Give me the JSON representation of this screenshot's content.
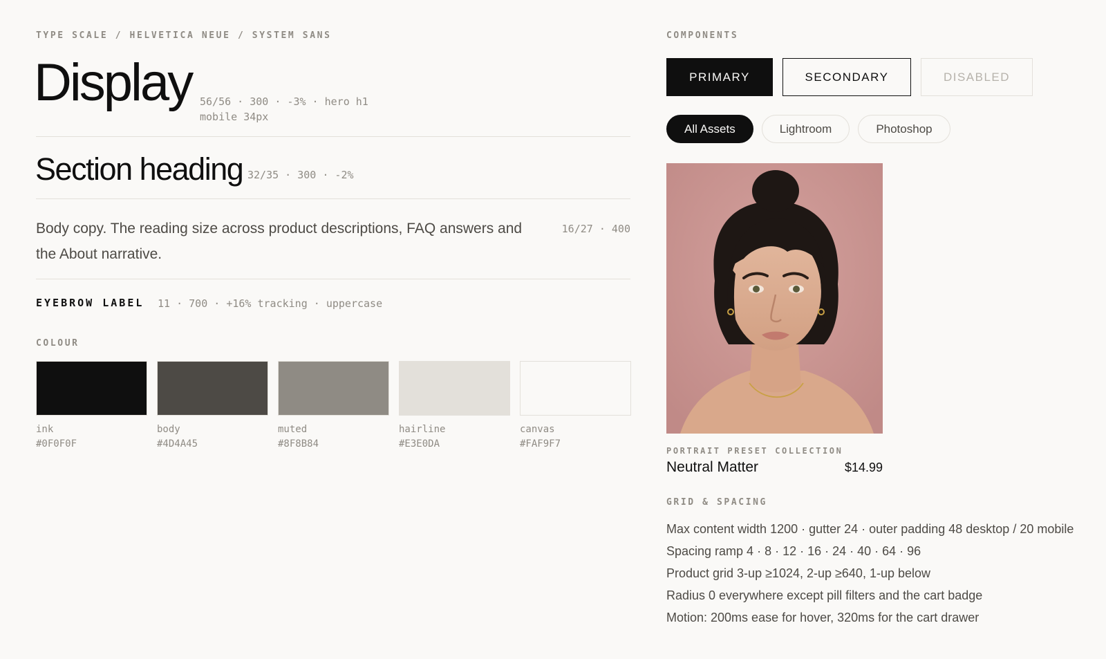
{
  "type_section": {
    "eyebrow": "TYPE SCALE / HELVETICA NEUE / SYSTEM SANS",
    "display": {
      "sample": "Display",
      "meta_line1": "56/56 · 300 · -3% · hero h1",
      "meta_line2": "mobile 34px"
    },
    "section": {
      "sample": "Section heading",
      "meta": "32/35 · 300 · -2%"
    },
    "body": {
      "sample": "Body copy. The reading size across product descriptions, FAQ answers and the About narrative.",
      "meta": "16/27 · 400"
    },
    "eyebrow_row": {
      "sample": "EYEBROW LABEL",
      "meta": "11 · 700 · +16% tracking · uppercase"
    }
  },
  "colour_section": {
    "eyebrow": "COLOUR",
    "swatches": [
      {
        "name": "ink",
        "hex": "#0F0F0F"
      },
      {
        "name": "body",
        "hex": "#4D4A45"
      },
      {
        "name": "muted",
        "hex": "#8F8B84"
      },
      {
        "name": "hairline",
        "hex": "#E3E0DA"
      },
      {
        "name": "canvas",
        "hex": "#FAF9F7"
      }
    ]
  },
  "components": {
    "eyebrow": "COMPONENTS",
    "buttons": {
      "primary": "PRIMARY",
      "secondary": "SECONDARY",
      "disabled": "DISABLED"
    },
    "pills": [
      "All Assets",
      "Lightroom",
      "Photoshop"
    ],
    "product_card": {
      "eyebrow": "PORTRAIT PRESET COLLECTION",
      "title": "Neutral Matter",
      "price": "$14.99",
      "image_icon": "portrait-photo"
    }
  },
  "grid_section": {
    "eyebrow": "GRID & SPACING",
    "lines": [
      "Max content width 1200 · gutter 24 · outer padding 48 desktop / 20 mobile",
      "Spacing ramp 4 · 8 · 12 · 16 · 24 · 40 · 64 · 96",
      "Product grid 3-up ≥1024, 2-up ≥640, 1-up below",
      "Radius 0 everywhere except pill filters and the cart badge",
      "Motion: 200ms ease for hover, 320ms for the cart drawer"
    ]
  }
}
